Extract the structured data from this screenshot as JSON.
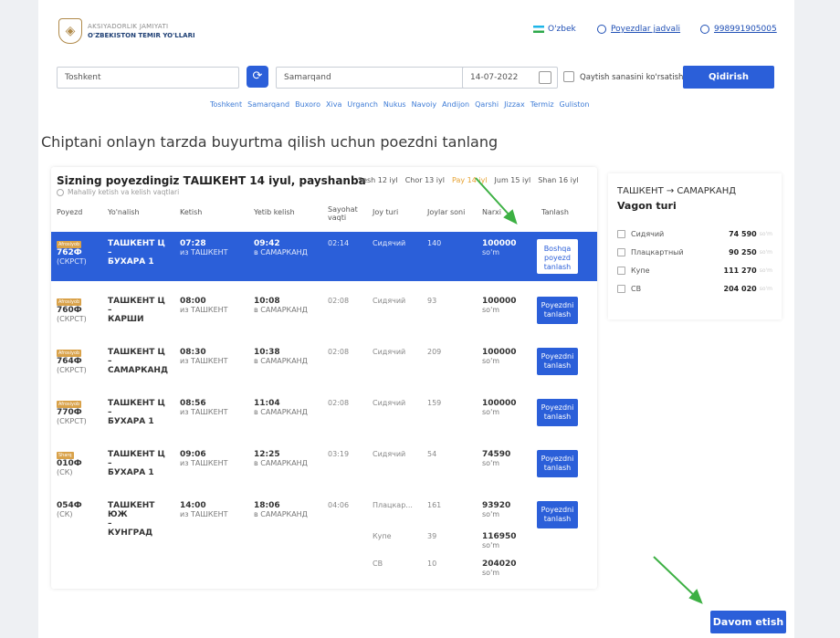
{
  "header": {
    "org_line1": "AKSIYADORLIK JAMIYATI",
    "org_line2": "O'ZBEKISTON TEMIR YO'LLARI",
    "language": "O'zbek",
    "timetable_link": "Poyezdlar jadvali",
    "phone": "998991905005"
  },
  "search": {
    "from": "Toshkent",
    "to": "Samarqand",
    "date": "14-07-2022",
    "return_label": "Qaytish sanasini ko'rsatish",
    "button": "Qidirish"
  },
  "cities": [
    "Toshkent",
    "Samarqand",
    "Buxoro",
    "Xiva",
    "Urganch",
    "Nukus",
    "Navoiy",
    "Andijon",
    "Qarshi",
    "Jizzax",
    "Termiz",
    "Guliston"
  ],
  "heading": "Chiptani onlayn tarzda buyurtma qilish uchun poezdni tanlang",
  "panel": {
    "title": "Sizning poyezdingiz ТАШКЕНТ 14 iyul, payshanba",
    "subtitle": "Mahalliy ketish va kelish vaqtlari",
    "dates": [
      "Sesh 12 iyl",
      "Chor 13 iyl",
      "Pay 14 iyl",
      "Jum 15 iyl",
      "Shan 16 iyl"
    ],
    "headers": [
      "Poyezd",
      "Yo'nalish",
      "Ketish",
      "Yetib kelish",
      "Sayohat vaqti",
      "Joy turi",
      "Joylar soni",
      "Narxi",
      "Tanlash"
    ]
  },
  "trains": [
    {
      "badge": "Afrosiyob",
      "num": "762Ф",
      "type": "(СКРСТ)",
      "from": "ТАШКЕНТ Ц",
      "to": "БУХАРА 1",
      "dep": "07:28",
      "dep_st": "из ТАШКЕНТ",
      "arr": "09:42",
      "arr_st": "в САМАРКАНД",
      "dur": "02:14",
      "seat": "Сидячий",
      "count": "140",
      "price": "100000",
      "cur": "so'm",
      "btn": "Boshqa poyezd tanlash"
    },
    {
      "badge": "Afrosiyob",
      "num": "760Ф",
      "type": "(СКРСТ)",
      "from": "ТАШКЕНТ Ц",
      "to": "КАРШИ",
      "dep": "08:00",
      "dep_st": "из ТАШКЕНТ",
      "arr": "10:08",
      "arr_st": "в САМАРКАНД",
      "dur": "02:08",
      "seat": "Сидячий",
      "count": "93",
      "price": "100000",
      "cur": "so'm",
      "btn": "Poyezdni tanlash"
    },
    {
      "badge": "Afrosiyob",
      "num": "764Ф",
      "type": "(СКРСТ)",
      "from": "ТАШКЕНТ Ц",
      "to": "САМАРКАНД",
      "dep": "08:30",
      "dep_st": "из ТАШКЕНТ",
      "arr": "10:38",
      "arr_st": "в САМАРКАНД",
      "dur": "02:08",
      "seat": "Сидячий",
      "count": "209",
      "price": "100000",
      "cur": "so'm",
      "btn": "Poyezdni tanlash"
    },
    {
      "badge": "Afrosiyob",
      "num": "770Ф",
      "type": "(СКРСТ)",
      "from": "ТАШКЕНТ Ц",
      "to": "БУХАРА 1",
      "dep": "08:56",
      "dep_st": "из ТАШКЕНТ",
      "arr": "11:04",
      "arr_st": "в САМАРКАНД",
      "dur": "02:08",
      "seat": "Сидячий",
      "count": "159",
      "price": "100000",
      "cur": "so'm",
      "btn": "Poyezdni tanlash"
    },
    {
      "badge": "Sharq",
      "num": "010Ф",
      "type": "(СК)",
      "from": "ТАШКЕНТ Ц",
      "to": "БУХАРА 1",
      "dep": "09:06",
      "dep_st": "из ТАШКЕНТ",
      "arr": "12:25",
      "arr_st": "в САМАРКАНД",
      "dur": "03:19",
      "seat": "Сидячий",
      "count": "54",
      "price": "74590",
      "cur": "so'm",
      "btn": "Poyezdni tanlash"
    }
  ],
  "train6": {
    "num": "054Ф",
    "type": "(СК)",
    "from": "ТАШКЕНТ ЮЖ",
    "to": "КУНГРАД",
    "dep": "14:00",
    "dep_st": "из ТАШКЕНТ",
    "arr": "18:06",
    "arr_st": "в САМАРКАНД",
    "dur": "04:06",
    "btn": "Poyezdni tanlash",
    "classes": [
      {
        "seat": "Плацкар...",
        "count": "161",
        "price": "93920",
        "cur": "so'm"
      },
      {
        "seat": "Купе",
        "count": "39",
        "price": "116950",
        "cur": "so'm"
      },
      {
        "seat": "СВ",
        "count": "10",
        "price": "204020",
        "cur": "so'm"
      }
    ]
  },
  "side": {
    "route": "ТАШКЕНТ → САМАРКАНД",
    "title": "Vagon turi",
    "items": [
      {
        "name": "Сидячий",
        "price": "74 590",
        "cur": "so'm"
      },
      {
        "name": "Плацкартный",
        "price": "90 250",
        "cur": "so'm"
      },
      {
        "name": "Купе",
        "price": "111 270",
        "cur": "so'm"
      },
      {
        "name": "СВ",
        "price": "204 020",
        "cur": "so'm"
      }
    ]
  },
  "continue_button": "Davom etish",
  "colors": {
    "accent": "#2b5fd9",
    "badge": "#d9a24a",
    "active_date": "#e7a333",
    "annotation": "#3cb043"
  }
}
